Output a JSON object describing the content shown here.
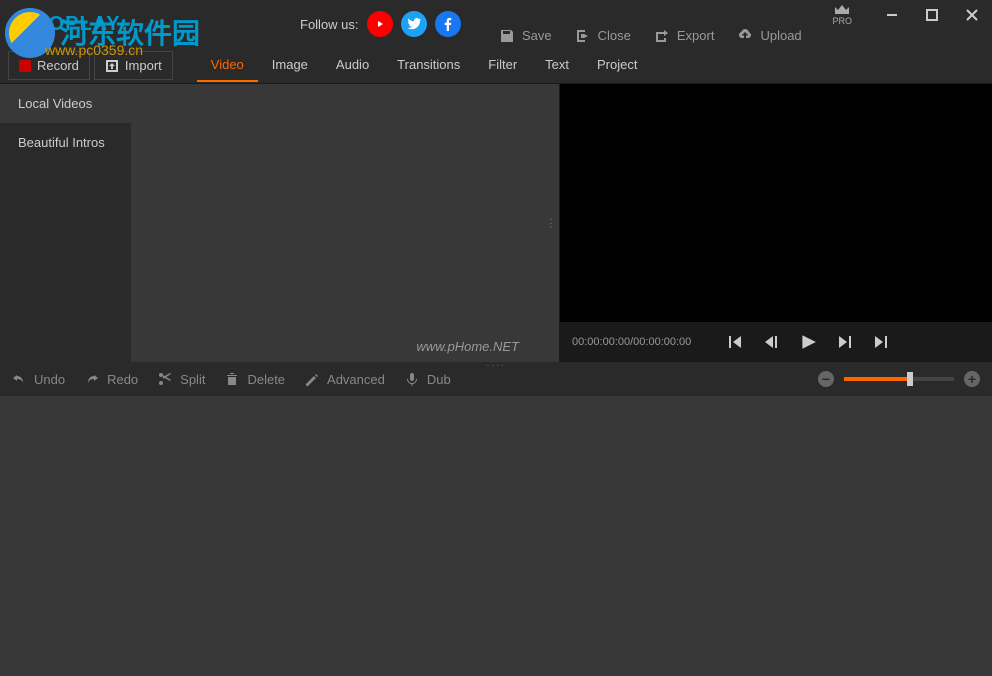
{
  "header": {
    "logo": "GOPLAY",
    "follow_label": "Follow us:",
    "pro_label": "PRO"
  },
  "top_actions": {
    "save": "Save",
    "close": "Close",
    "export": "Export",
    "upload": "Upload"
  },
  "toolbar": {
    "record": "Record",
    "import": "Import"
  },
  "media_tabs": [
    "Video",
    "Image",
    "Audio",
    "Transitions",
    "Filter",
    "Text",
    "Project"
  ],
  "sidebar": {
    "items": [
      "Local Videos",
      "Beautiful Intros"
    ]
  },
  "watermark": "www.pHome.NET",
  "preview": {
    "timecode": "00:00:00:00/00:00:00:00"
  },
  "edit_actions": {
    "undo": "Undo",
    "redo": "Redo",
    "split": "Split",
    "delete": "Delete",
    "advanced": "Advanced",
    "dub": "Dub"
  },
  "overlay": {
    "title": "河东软件园",
    "url": "www.pc0359.cn"
  }
}
